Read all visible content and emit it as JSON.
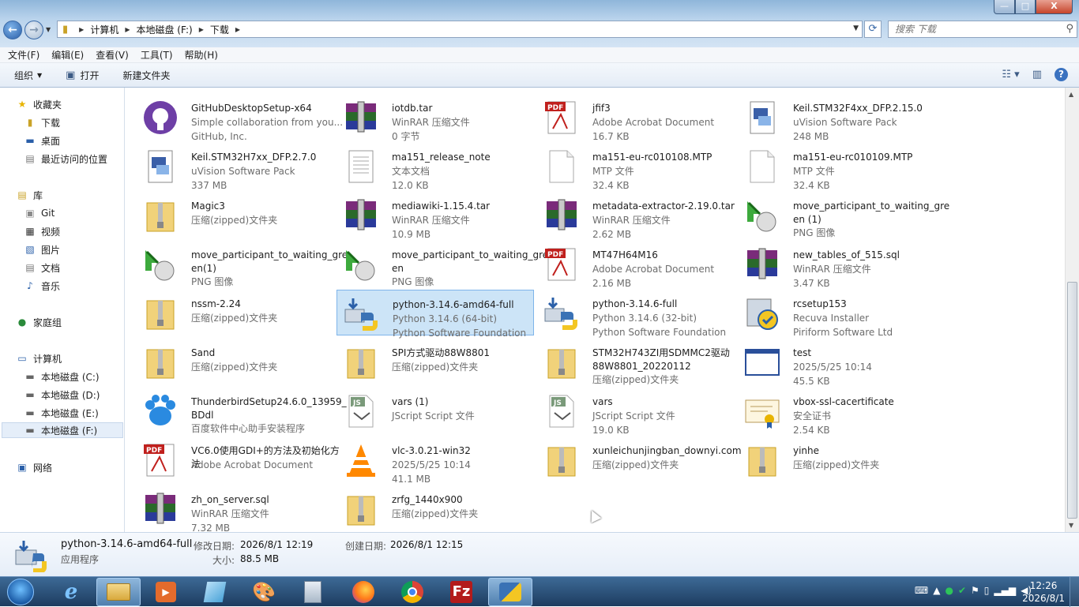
{
  "window": {
    "buttons": {
      "minimize": "—",
      "maximize": "□",
      "close": "X"
    }
  },
  "address": {
    "crumbs": [
      "计算机",
      "本地磁盘 (F:)",
      "下载"
    ]
  },
  "search": {
    "placeholder": "搜索 下载"
  },
  "menu": [
    "文件(F)",
    "编辑(E)",
    "查看(V)",
    "工具(T)",
    "帮助(H)"
  ],
  "toolbar": {
    "organize": "组织",
    "open": "打开",
    "new_folder": "新建文件夹"
  },
  "sidebar": {
    "favorites": "收藏夹",
    "fav_items": [
      "下载",
      "桌面",
      "最近访问的位置"
    ],
    "libraries": "库",
    "lib_items": [
      "Git",
      "视频",
      "图片",
      "文档",
      "音乐"
    ],
    "homegroup": "家庭组",
    "computer": "计算机",
    "drives": [
      "本地磁盘 (C:)",
      "本地磁盘 (D:)",
      "本地磁盘 (E:)",
      "本地磁盘 (F:)"
    ],
    "network": "网络"
  },
  "files": [
    {
      "name": "GitHubDesktopSetup-x64",
      "l1": "Simple collaboration from you...",
      "l2": "GitHub, Inc.",
      "icon": "github"
    },
    {
      "name": "iotdb.tar",
      "l1": "WinRAR 压缩文件",
      "l2": "0 字节",
      "icon": "rar"
    },
    {
      "name": "jfif3",
      "l1": "Adobe Acrobat Document",
      "l2": "16.7 KB",
      "icon": "pdf"
    },
    {
      "name": "Keil.STM32F4xx_DFP.2.15.0",
      "l1": "uVision Software Pack",
      "l2": "248 MB",
      "icon": "pack"
    },
    {
      "name": "Keil.STM32H7xx_DFP.2.7.0",
      "l1": "uVision Software Pack",
      "l2": "337 MB",
      "icon": "pack"
    },
    {
      "name": "ma151_release_note",
      "l1": "文本文档",
      "l2": "12.0 KB",
      "icon": "txt"
    },
    {
      "name": "ma151-eu-rc010108.MTP",
      "l1": "MTP 文件",
      "l2": "32.4 KB",
      "icon": "blank"
    },
    {
      "name": "ma151-eu-rc010109.MTP",
      "l1": "MTP 文件",
      "l2": "32.4 KB",
      "icon": "blank"
    },
    {
      "name": "Magic3",
      "l1": "压缩(zipped)文件夹",
      "l2": "",
      "icon": "zip"
    },
    {
      "name": "mediawiki-1.15.4.tar",
      "l1": "WinRAR 压缩文件",
      "l2": "10.9 MB",
      "icon": "rar"
    },
    {
      "name": "metadata-extractor-2.19.0.tar",
      "l1": "WinRAR 压缩文件",
      "l2": "2.62 MB",
      "icon": "rar"
    },
    {
      "name": "move_participant_to_waiting_gre en (1)",
      "l1": "PNG 图像",
      "l2": "",
      "icon": "png"
    },
    {
      "name": "move_participant_to_waiting_gre en(1)",
      "l1": "PNG 图像",
      "l2": "",
      "icon": "png"
    },
    {
      "name": "move_participant_to_waiting_gre en",
      "l1": "PNG 图像",
      "l2": "",
      "icon": "png"
    },
    {
      "name": "MT47H64M16",
      "l1": "Adobe Acrobat Document",
      "l2": "2.16 MB",
      "icon": "pdf"
    },
    {
      "name": "new_tables_of_515.sql",
      "l1": "WinRAR 压缩文件",
      "l2": "3.47 KB",
      "icon": "rar"
    },
    {
      "name": "nssm-2.24",
      "l1": "压缩(zipped)文件夹",
      "l2": "",
      "icon": "zip"
    },
    {
      "name": "python-3.14.6-amd64-full",
      "l1": "Python 3.14.6 (64-bit)",
      "l2": "Python Software Foundation",
      "icon": "python",
      "selected": true
    },
    {
      "name": "python-3.14.6-full",
      "l1": "Python 3.14.6 (32-bit)",
      "l2": "Python Software Foundation",
      "icon": "python"
    },
    {
      "name": "rcsetup153",
      "l1": "Recuva Installer",
      "l2": "Piriform Software Ltd",
      "icon": "recuva"
    },
    {
      "name": "Sand",
      "l1": "压缩(zipped)文件夹",
      "l2": "",
      "icon": "zip"
    },
    {
      "name": "SPI方式驱动88W8801",
      "l1": "压缩(zipped)文件夹",
      "l2": "",
      "icon": "zip"
    },
    {
      "name": "STM32H743ZI用SDMMC2驱动 88W8801_20220112",
      "l1": "压缩(zipped)文件夹",
      "l2": "",
      "icon": "zip"
    },
    {
      "name": "test",
      "l1": "2025/5/25 10:14",
      "l2": "45.5 KB",
      "icon": "window"
    },
    {
      "name": "ThunderbirdSetup24.6.0_13959_ BDdl",
      "l1": "百度软件中心助手安装程序",
      "l2": "",
      "icon": "baidu"
    },
    {
      "name": "vars (1)",
      "l1": "JScript Script 文件",
      "l2": "",
      "icon": "js"
    },
    {
      "name": "vars",
      "l1": "JScript Script 文件",
      "l2": "19.0 KB",
      "icon": "js"
    },
    {
      "name": "vbox-ssl-cacertificate",
      "l1": "安全证书",
      "l2": "2.54 KB",
      "icon": "cert"
    },
    {
      "name": "VC6.0使用GDI+的方法及初始化方 法",
      "l1": "Adobe Acrobat Document",
      "l2": "",
      "icon": "pdf"
    },
    {
      "name": "vlc-3.0.21-win32",
      "l1": "2025/5/25 10:14",
      "l2": "41.1 MB",
      "icon": "vlc"
    },
    {
      "name": "xunleichunjingban_downyi.com",
      "l1": "压缩(zipped)文件夹",
      "l2": "",
      "icon": "zip"
    },
    {
      "name": "yinhe",
      "l1": "压缩(zipped)文件夹",
      "l2": "",
      "icon": "zip"
    },
    {
      "name": "zh_on_server.sql",
      "l1": "WinRAR 压缩文件",
      "l2": "7.32 MB",
      "icon": "rar"
    },
    {
      "name": "zrfg_1440x900",
      "l1": "压缩(zipped)文件夹",
      "l2": "",
      "icon": "zip"
    }
  ],
  "details": {
    "name": "python-3.14.6-amd64-full",
    "type": "应用程序",
    "modified_label": "修改日期:",
    "modified": "2026/8/1 12:19",
    "created_label": "创建日期:",
    "created": "2026/8/1 12:15",
    "size_label": "大小:",
    "size": "88.5 MB"
  },
  "taskbar": {
    "time": "12:26",
    "date": "2026/8/1"
  }
}
